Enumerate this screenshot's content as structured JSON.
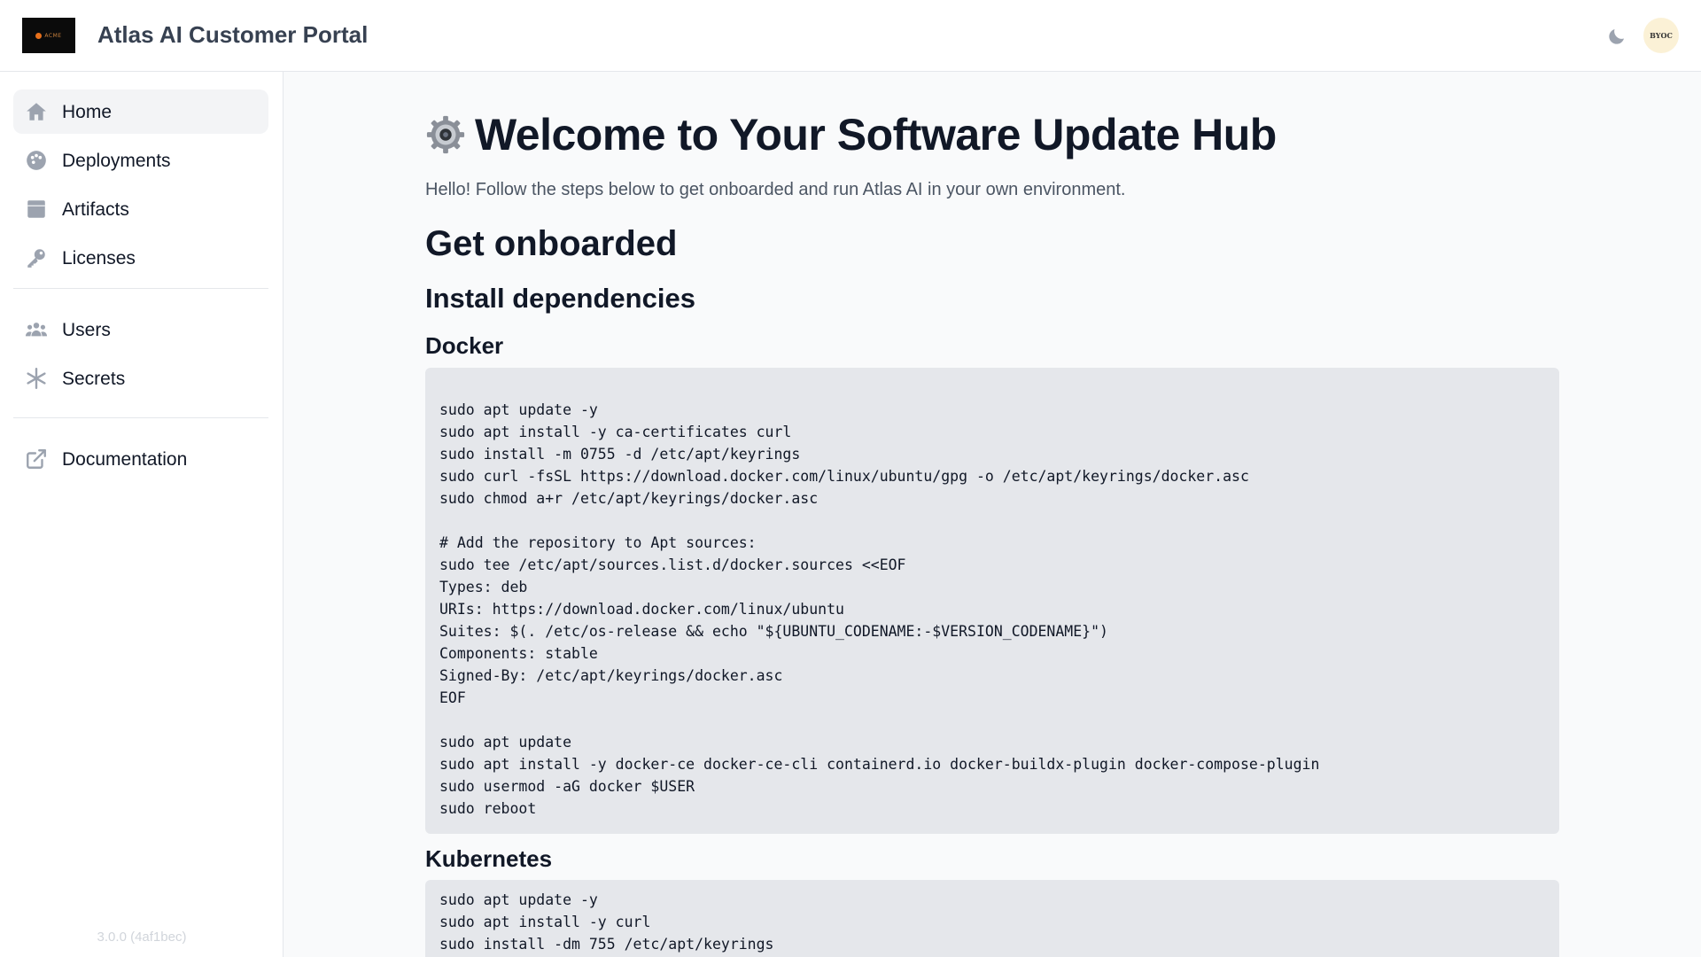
{
  "header": {
    "logo_text": "ACME",
    "title": "Atlas AI Customer Portal",
    "theme_toggle_icon": "moon-icon",
    "avatar_text": "BYOC"
  },
  "sidebar": {
    "items": [
      {
        "label": "Home",
        "icon": "home-icon",
        "active": true
      },
      {
        "label": "Deployments",
        "icon": "palette-icon",
        "active": false
      },
      {
        "label": "Artifacts",
        "icon": "box-icon",
        "active": false
      },
      {
        "label": "Licenses",
        "icon": "key-icon",
        "active": false
      },
      {
        "label": "Users",
        "icon": "users-icon",
        "active": false
      },
      {
        "label": "Secrets",
        "icon": "asterisk-icon",
        "active": false
      },
      {
        "label": "Documentation",
        "icon": "external-link-icon",
        "active": false
      }
    ],
    "version": "3.0.0 (4af1bec)"
  },
  "main": {
    "title": "Welcome to Your Software Update Hub",
    "intro": "Hello! Follow the steps below to get onboarded and run Atlas AI in your own environment.",
    "section_title": "Get onboarded",
    "subsection_title": "Install dependencies",
    "docker": {
      "heading": "Docker",
      "code": "sudo apt update -y\nsudo apt install -y ca-certificates curl\nsudo install -m 0755 -d /etc/apt/keyrings\nsudo curl -fsSL https://download.docker.com/linux/ubuntu/gpg -o /etc/apt/keyrings/docker.asc\nsudo chmod a+r /etc/apt/keyrings/docker.asc\n\n# Add the repository to Apt sources:\nsudo tee /etc/apt/sources.list.d/docker.sources <<EOF\nTypes: deb\nURIs: https://download.docker.com/linux/ubuntu\nSuites: $(. /etc/os-release && echo \"${UBUNTU_CODENAME:-$VERSION_CODENAME}\")\nComponents: stable\nSigned-By: /etc/apt/keyrings/docker.asc\nEOF\n\nsudo apt update\nsudo apt install -y docker-ce docker-ce-cli containerd.io docker-buildx-plugin docker-compose-plugin\nsudo usermod -aG docker $USER\nsudo reboot"
    },
    "kubernetes": {
      "heading": "Kubernetes",
      "code": "sudo apt update -y\nsudo apt install -y curl\nsudo install -dm 755 /etc/apt/keyrings"
    }
  },
  "colors": {
    "background": "#f9fafb",
    "sidebar_active": "#f3f4f6",
    "code_background": "#e5e7eb",
    "icon_gray": "#9ca3af"
  }
}
